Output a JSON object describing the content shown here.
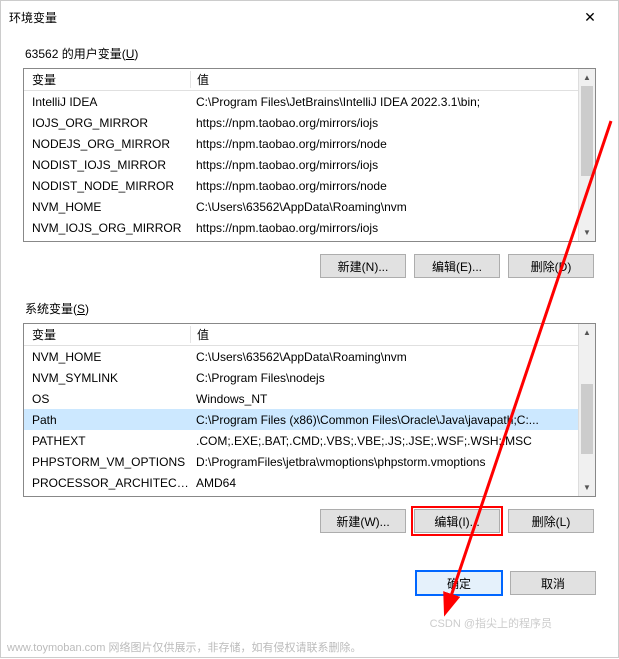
{
  "dialog": {
    "title": "环境变量",
    "close_icon": "✕"
  },
  "user_section": {
    "label_prefix": "63562 的用户变量(",
    "label_key": "U",
    "label_suffix": ")",
    "header_var": "变量",
    "header_val": "值",
    "rows": [
      {
        "name": "IntelliJ IDEA",
        "value": "C:\\Program Files\\JetBrains\\IntelliJ IDEA 2022.3.1\\bin;"
      },
      {
        "name": "IOJS_ORG_MIRROR",
        "value": "https://npm.taobao.org/mirrors/iojs"
      },
      {
        "name": "NODEJS_ORG_MIRROR",
        "value": "https://npm.taobao.org/mirrors/node"
      },
      {
        "name": "NODIST_IOJS_MIRROR",
        "value": "https://npm.taobao.org/mirrors/iojs"
      },
      {
        "name": "NODIST_NODE_MIRROR",
        "value": "https://npm.taobao.org/mirrors/node"
      },
      {
        "name": "NVM_HOME",
        "value": "C:\\Users\\63562\\AppData\\Roaming\\nvm"
      },
      {
        "name": "NVM_IOJS_ORG_MIRROR",
        "value": "https://npm.taobao.org/mirrors/iojs"
      }
    ],
    "buttons": {
      "new": "新建(N)...",
      "edit": "编辑(E)...",
      "delete": "删除(D)"
    }
  },
  "system_section": {
    "label_prefix": "系统变量(",
    "label_key": "S",
    "label_suffix": ")",
    "header_var": "变量",
    "header_val": "值",
    "selected_index": 3,
    "rows": [
      {
        "name": "NVM_HOME",
        "value": "C:\\Users\\63562\\AppData\\Roaming\\nvm"
      },
      {
        "name": "NVM_SYMLINK",
        "value": "C:\\Program Files\\nodejs"
      },
      {
        "name": "OS",
        "value": "Windows_NT"
      },
      {
        "name": "Path",
        "value": "C:\\Program Files (x86)\\Common Files\\Oracle\\Java\\javapath;C:..."
      },
      {
        "name": "PATHEXT",
        "value": ".COM;.EXE;.BAT;.CMD;.VBS;.VBE;.JS;.JSE;.WSF;.WSH;.MSC"
      },
      {
        "name": "PHPSTORM_VM_OPTIONS",
        "value": "D:\\ProgramFiles\\jetbra\\vmoptions\\phpstorm.vmoptions"
      },
      {
        "name": "PROCESSOR_ARCHITECT...",
        "value": "AMD64"
      }
    ],
    "buttons": {
      "new": "新建(W)...",
      "edit": "编辑(I)...",
      "delete": "删除(L)"
    }
  },
  "bottom": {
    "ok": "确定",
    "cancel": "取消"
  },
  "watermark": {
    "left": "www.toymoban.com  网络图片仅供展示，非存储，如有侵权请联系删除。",
    "right": "CSDN @指尖上的程序员"
  }
}
